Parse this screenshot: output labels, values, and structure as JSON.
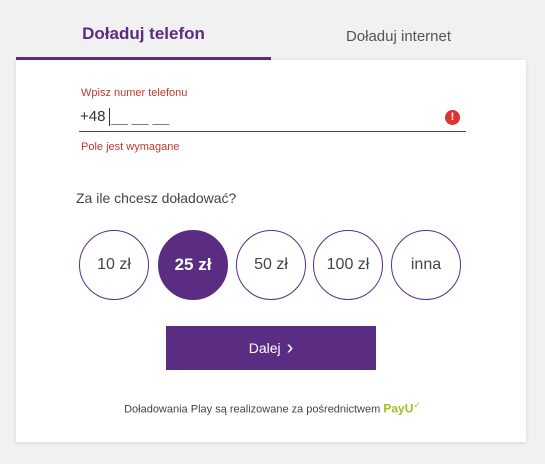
{
  "tabs": [
    {
      "label": "Doładuj telefon",
      "active": true
    },
    {
      "label": "Doładuj internet",
      "active": false
    }
  ],
  "phone": {
    "label": "Wpisz numer telefonu",
    "prefix": "+48",
    "value": "",
    "placeholder": "__ __ __",
    "error": "Pole jest wymagane",
    "error_icon": "!"
  },
  "amounts": {
    "question": "Za ile chcesz doładować?",
    "options": [
      "10 zł",
      "25 zł",
      "50 zł",
      "100 zł",
      "inna"
    ],
    "selected": "25 zł"
  },
  "next": {
    "label": "Dalej",
    "icon": "chevron-right-icon",
    "icon_glyph": "›"
  },
  "footer": {
    "text": "Doładowania Play są realizowane za pośrednictwem",
    "brand": "PayU",
    "brand_mark": "✓"
  },
  "colors": {
    "accent": "#5a2d82",
    "error": "#c0392b",
    "brand": "#9bc31c"
  }
}
